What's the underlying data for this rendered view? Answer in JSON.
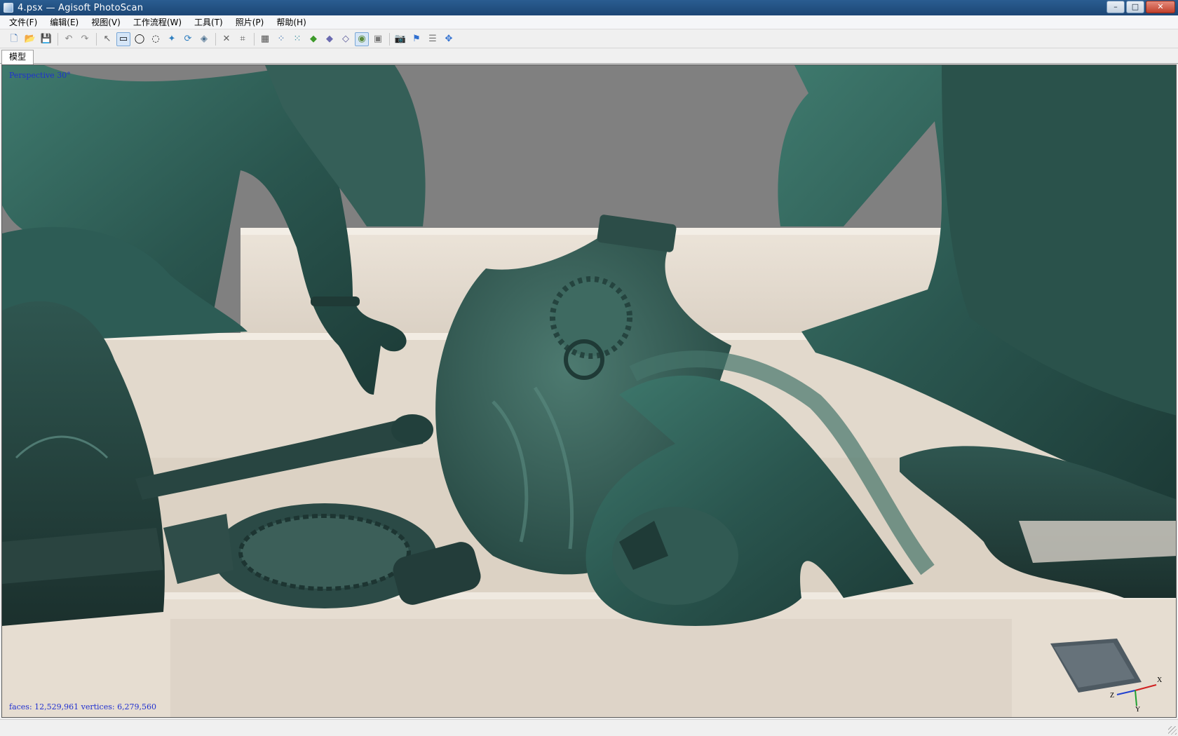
{
  "window": {
    "title": "4.psx — Agisoft PhotoScan",
    "controls": {
      "minimize": "–",
      "maximize": "□",
      "close": "✕"
    }
  },
  "menu": [
    {
      "label": "文件(F)"
    },
    {
      "label": "编辑(E)"
    },
    {
      "label": "视图(V)"
    },
    {
      "label": "工作流程(W)"
    },
    {
      "label": "工具(T)"
    },
    {
      "label": "照片(P)"
    },
    {
      "label": "帮助(H)"
    }
  ],
  "toolbar": {
    "icons": [
      "new-file-icon",
      "open-folder-icon",
      "save-icon",
      "undo-icon",
      "redo-icon",
      "navigation-icon",
      "rectangle-select-icon",
      "circle-select-icon",
      "free-select-icon",
      "select-points-icon",
      "reset-selection-icon",
      "gradual-select-icon",
      "delete-icon",
      "crop-icon",
      "show-cameras-icon",
      "show-points-icon",
      "show-dense-cloud-icon",
      "show-model-shaded-icon",
      "show-model-solid-icon",
      "show-model-wireframe-icon",
      "show-model-textured-icon",
      "show-tiled-model-icon",
      "capture-view-icon",
      "markers-icon",
      "shapes-icon",
      "region-move-icon"
    ],
    "glyphs": {
      "new": "🗋",
      "open": "📂",
      "save": "💾",
      "undo": "↶",
      "redo": "↷",
      "navigation": "↖",
      "rect": "▭",
      "circle": "◯",
      "free": "◌",
      "select_points": "✦",
      "reset": "⟳",
      "gradual": "◈",
      "delete": "✕",
      "crop": "⌗",
      "cameras": "▦",
      "points": "⁘",
      "dense": "⁙",
      "shaded": "◆",
      "solid": "◆",
      "wire": "◇",
      "textured": "◉",
      "tiled": "▣",
      "capture": "📷",
      "markers": "⚑",
      "shapes": "☰",
      "region": "✥"
    }
  },
  "tabs": [
    {
      "label": "模型"
    }
  ],
  "viewport": {
    "projection_label": "Perspective 30°",
    "stats_label": "faces: 12,529,961 vertices: 6,279,560",
    "axes": {
      "x": "X",
      "y": "Y",
      "z": "Z"
    },
    "colors": {
      "background": "#808080",
      "bronze": "#2e5a52",
      "stone": "#e5ddd2",
      "overlay_text": "#2030d0"
    }
  }
}
